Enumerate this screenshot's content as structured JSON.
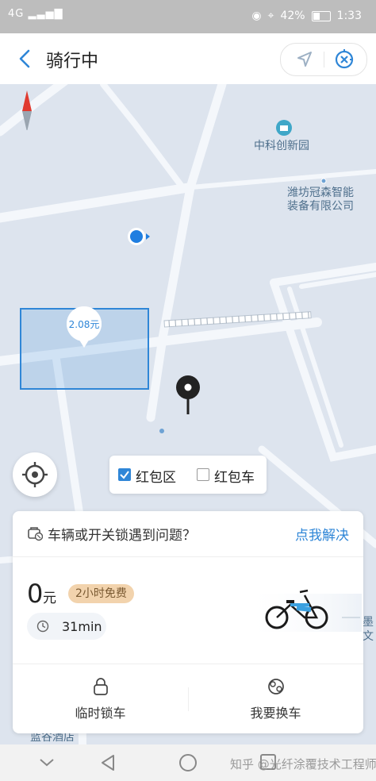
{
  "status_bar": {
    "network": "4G",
    "battery": "42%",
    "time": "1:33"
  },
  "header": {
    "title": "骑行中"
  },
  "map": {
    "pois": [
      {
        "name": "中科创新园"
      },
      {
        "name_line1": "潍坊冠森智能",
        "name_line2": "装备有限公司"
      },
      {
        "name": "蓝谷酒店"
      }
    ],
    "edge_text_1": "墨",
    "edge_text_2": "文"
  },
  "red_packet_zone": {
    "amount": "2.08元"
  },
  "legend": {
    "zone_label": "红包区",
    "zone_checked": true,
    "bike_label": "红包车",
    "bike_checked": false
  },
  "ride_card": {
    "issue_text": "车辆或开关锁遇到问题？",
    "issue_link": "点我解决",
    "fee_amount": "0",
    "fee_unit": "元",
    "free_badge": "2小时免费",
    "duration": "31min",
    "actions": [
      {
        "label": "临时锁车",
        "icon": "lock-icon"
      },
      {
        "label": "我要换车",
        "icon": "switch-bike-icon"
      }
    ]
  },
  "watermark": "知乎 @光纤涂覆技术工程师",
  "colors": {
    "accent": "#2f86d7",
    "map_bg": "#dde4ee",
    "road": "#f4f7fb",
    "zone": "#2f86d7"
  }
}
